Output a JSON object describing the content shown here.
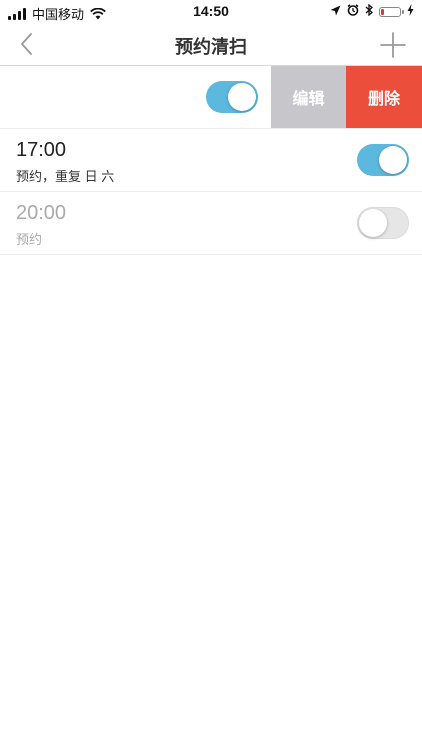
{
  "status_bar": {
    "carrier": "中国移动",
    "time": "14:50",
    "battery_color": "#e23b2e"
  },
  "nav": {
    "title": "预约清扫",
    "back_icon": "chevron-left-icon",
    "add_icon": "plus-icon"
  },
  "swiped_row": {
    "toggle_on": true,
    "edit_label": "编辑",
    "delete_label": "删除"
  },
  "schedules": [
    {
      "time": "17:00",
      "description": "预约，重复  日  六",
      "enabled": true
    },
    {
      "time": "20:00",
      "description": "预约",
      "enabled": false
    }
  ],
  "colors": {
    "toggle_on": "#5db8dd",
    "edit_bg": "#c7c6cb",
    "delete_bg": "#ec4e3c"
  }
}
